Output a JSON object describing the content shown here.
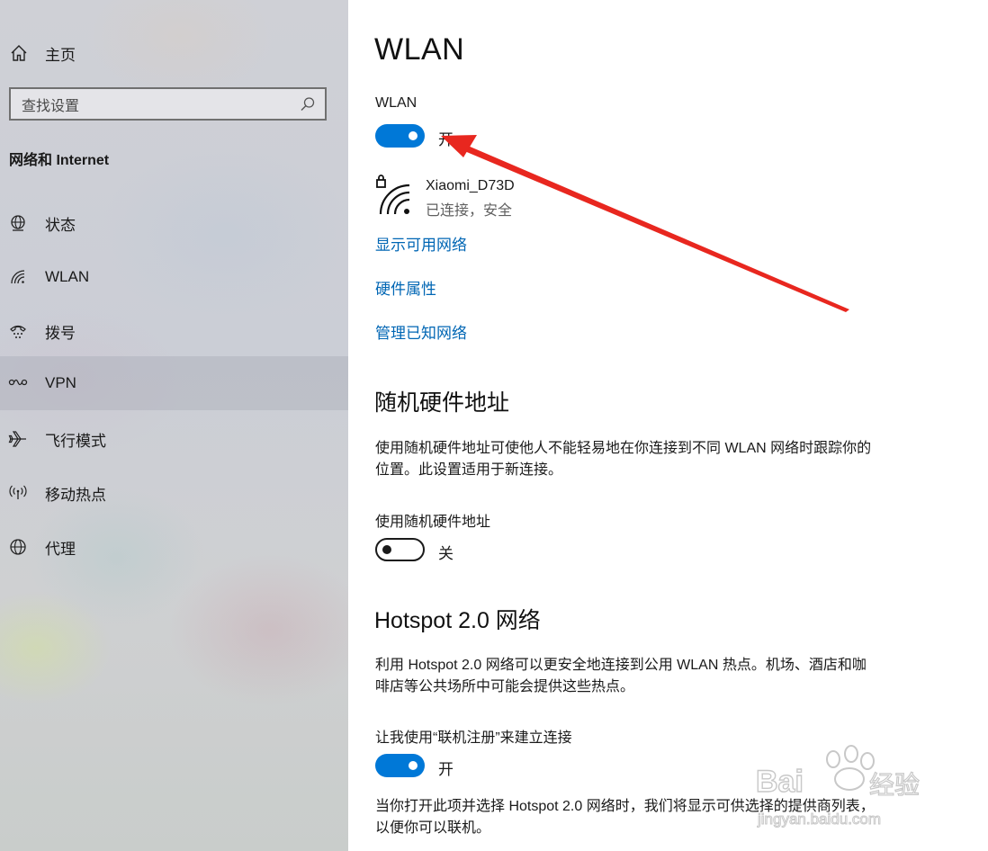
{
  "sidebar": {
    "home_label": "主页",
    "search_placeholder": "查找设置",
    "section_title": "网络和 Internet",
    "items": [
      {
        "label": "状态",
        "icon": "globe-network-icon"
      },
      {
        "label": "WLAN",
        "icon": "wifi-icon"
      },
      {
        "label": "拨号",
        "icon": "dialup-icon"
      },
      {
        "label": "VPN",
        "icon": "vpn-icon"
      },
      {
        "label": "飞行模式",
        "icon": "airplane-icon"
      },
      {
        "label": "移动热点",
        "icon": "hotspot-icon"
      },
      {
        "label": "代理",
        "icon": "globe-icon"
      }
    ]
  },
  "main": {
    "title": "WLAN",
    "wlan": {
      "label": "WLAN",
      "state_text": "开",
      "on": true
    },
    "network": {
      "name": "Xiaomi_D73D",
      "status": "已连接，安全"
    },
    "links": [
      "显示可用网络",
      "硬件属性",
      "管理已知网络"
    ],
    "random_hw": {
      "heading": "随机硬件地址",
      "description": "使用随机硬件地址可使他人不能轻易地在你连接到不同 WLAN 网络时跟踪你的位置。此设置适用于新连接。",
      "toggle_label": "使用随机硬件地址",
      "state_text": "关",
      "on": false
    },
    "hotspot": {
      "heading": "Hotspot 2.0 网络",
      "description": "利用 Hotspot 2.0 网络可以更安全地连接到公用 WLAN 热点。机场、酒店和咖啡店等公共场所中可能会提供这些热点。",
      "toggle_label": "让我使用“联机注册”来建立连接",
      "state_text": "开",
      "on": true,
      "note": "当你打开此项并选择 Hotspot 2.0 网络时，我们将显示可供选择的提供商列表，以便你可以联机。"
    }
  },
  "colors": {
    "accent": "#0078d7",
    "link": "#0066b4",
    "arrow": "#e8271f"
  },
  "watermark": {
    "brand": "Baidu",
    "cn": "经验",
    "url": "jingyan.baidu.com"
  }
}
